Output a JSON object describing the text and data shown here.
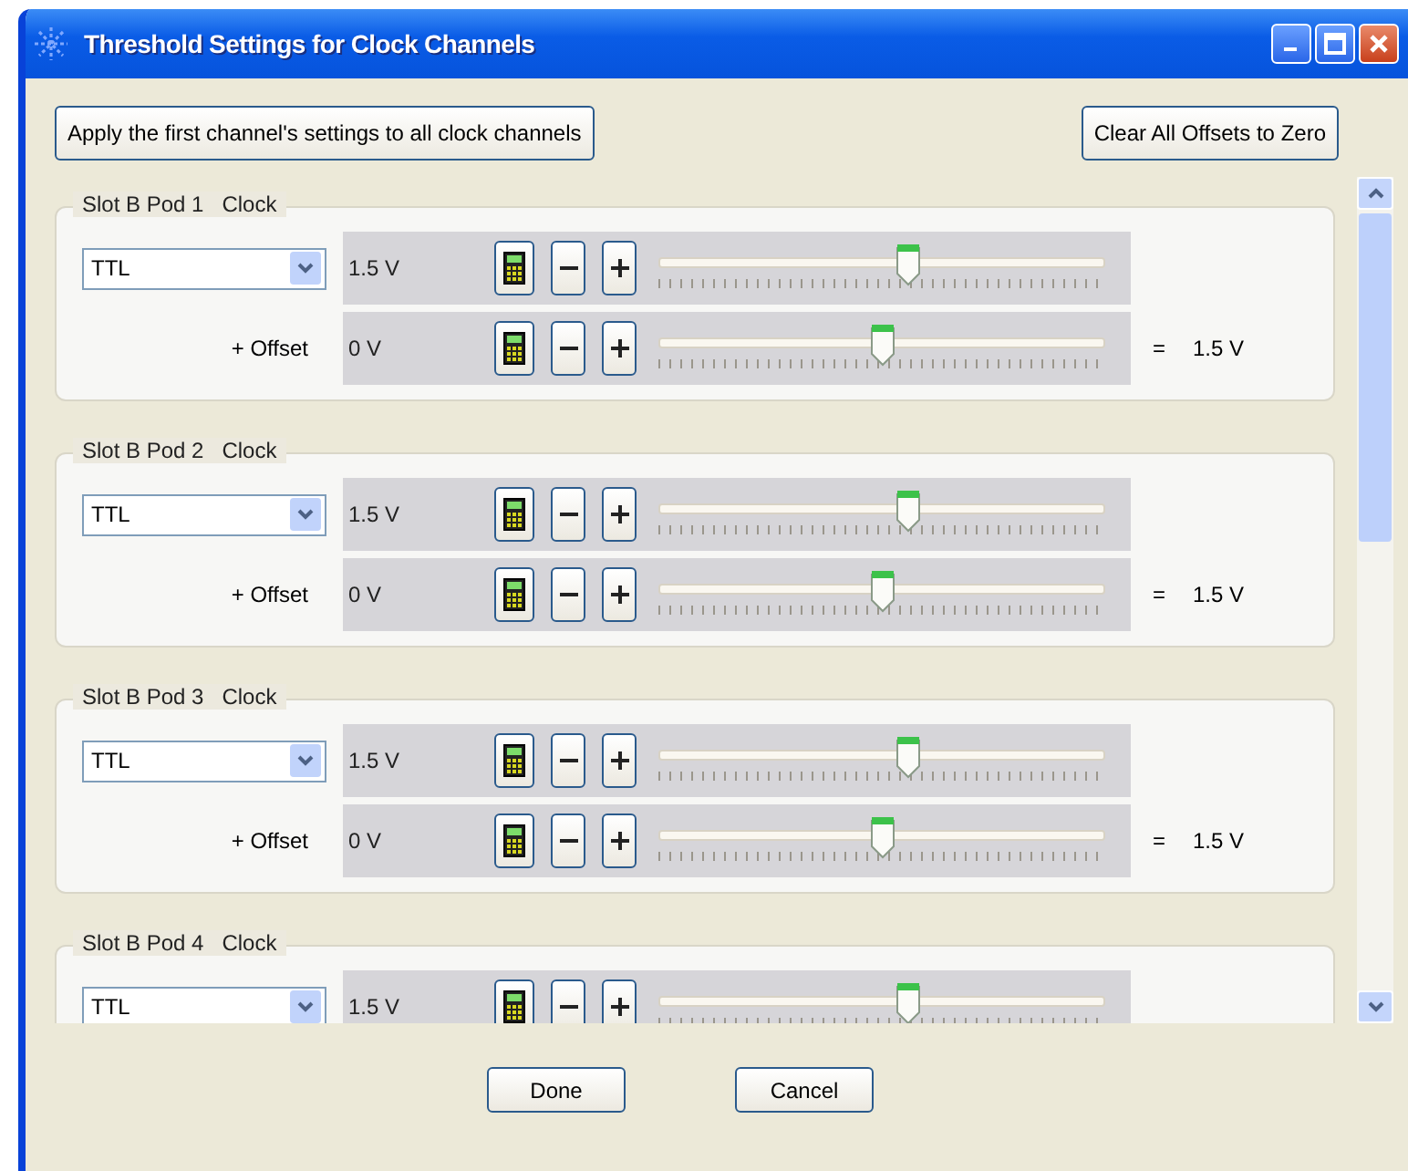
{
  "window": {
    "title": "Threshold Settings for Clock Channels"
  },
  "actions": {
    "apply": "Apply the first channel's settings to all clock channels",
    "clear": "Clear All Offsets to Zero"
  },
  "channels": [
    {
      "slot": "Slot B Pod 1",
      "type": "Clock",
      "standard": "TTL",
      "threshold": {
        "value": "1.5 V",
        "level": 0.56
      },
      "offset": {
        "label": "+ Offset",
        "value": "0 V",
        "level": 0.5
      },
      "result": {
        "equals": "=",
        "value": "1.5 V"
      }
    },
    {
      "slot": "Slot B Pod 2",
      "type": "Clock",
      "standard": "TTL",
      "threshold": {
        "value": "1.5 V",
        "level": 0.56
      },
      "offset": {
        "label": "+ Offset",
        "value": "0 V",
        "level": 0.5
      },
      "result": {
        "equals": "=",
        "value": "1.5 V"
      }
    },
    {
      "slot": "Slot B Pod 3",
      "type": "Clock",
      "standard": "TTL",
      "threshold": {
        "value": "1.5 V",
        "level": 0.56
      },
      "offset": {
        "label": "+ Offset",
        "value": "0 V",
        "level": 0.5
      },
      "result": {
        "equals": "=",
        "value": "1.5 V"
      }
    },
    {
      "slot": "Slot B Pod 4",
      "type": "Clock",
      "standard": "TTL",
      "threshold": {
        "value": "1.5 V",
        "level": 0.56
      }
    }
  ],
  "buttons": [
    "Done",
    "Cancel"
  ]
}
